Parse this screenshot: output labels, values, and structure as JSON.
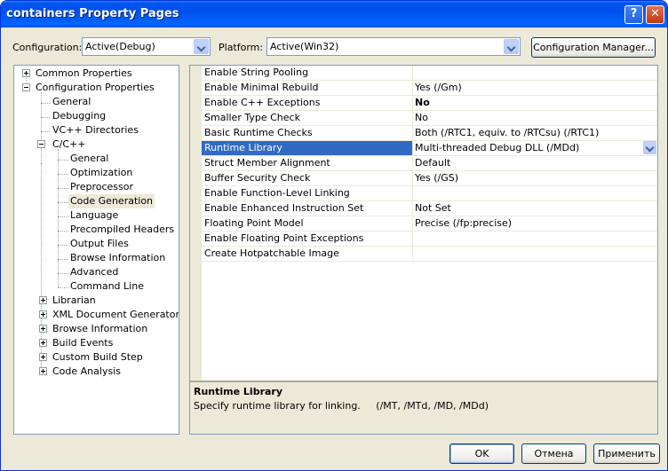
{
  "window": {
    "title": "containers Property Pages",
    "help_label": "?",
    "close_label": "✕"
  },
  "config": {
    "label": "Configuration:",
    "value": "Active(Debug)",
    "platform_label": "Platform:",
    "platform_value": "Active(Win32)",
    "manager_label": "Configuration Manager..."
  },
  "tree": {
    "common": "Common Properties",
    "config_props": "Configuration Properties",
    "general": "General",
    "debugging": "Debugging",
    "vc_dirs": "VC++ Directories",
    "cpp": "C/C++",
    "cpp_items": [
      "General",
      "Optimization",
      "Preprocessor",
      "Code Generation",
      "Language",
      "Precompiled Headers",
      "Output Files",
      "Browse Information",
      "Advanced",
      "Command Line"
    ],
    "more": [
      "Librarian",
      "XML Document Generator",
      "Browse Information",
      "Build Events",
      "Custom Build Step",
      "Code Analysis"
    ]
  },
  "grid": {
    "rows": [
      {
        "name": "Enable String Pooling",
        "value": ""
      },
      {
        "name": "Enable Minimal Rebuild",
        "value": "Yes (/Gm)"
      },
      {
        "name": "Enable C++ Exceptions",
        "value": "No"
      },
      {
        "name": "Smaller Type Check",
        "value": "No"
      },
      {
        "name": "Basic Runtime Checks",
        "value": "Both (/RTC1, equiv. to /RTCsu) (/RTC1)"
      },
      {
        "name": "Runtime Library",
        "value": "Multi-threaded Debug DLL (/MDd)"
      },
      {
        "name": "Struct Member Alignment",
        "value": "Default"
      },
      {
        "name": "Buffer Security Check",
        "value": "Yes (/GS)"
      },
      {
        "name": "Enable Function-Level Linking",
        "value": ""
      },
      {
        "name": "Enable Enhanced Instruction Set",
        "value": "Not Set"
      },
      {
        "name": "Floating Point Model",
        "value": "Precise (/fp:precise)"
      },
      {
        "name": "Enable Floating Point Exceptions",
        "value": ""
      },
      {
        "name": "Create Hotpatchable Image",
        "value": ""
      }
    ]
  },
  "description": {
    "title": "Runtime Library",
    "text": "Specify runtime library for linking.     (/MT, /MTd, /MD, /MDd)"
  },
  "buttons": {
    "ok": "OK",
    "cancel": "Отмена",
    "apply": "Применить"
  },
  "colors": {
    "titlebar": "#0053ee",
    "selection": "#316ac5",
    "dialog_bg": "#ece9d8"
  }
}
